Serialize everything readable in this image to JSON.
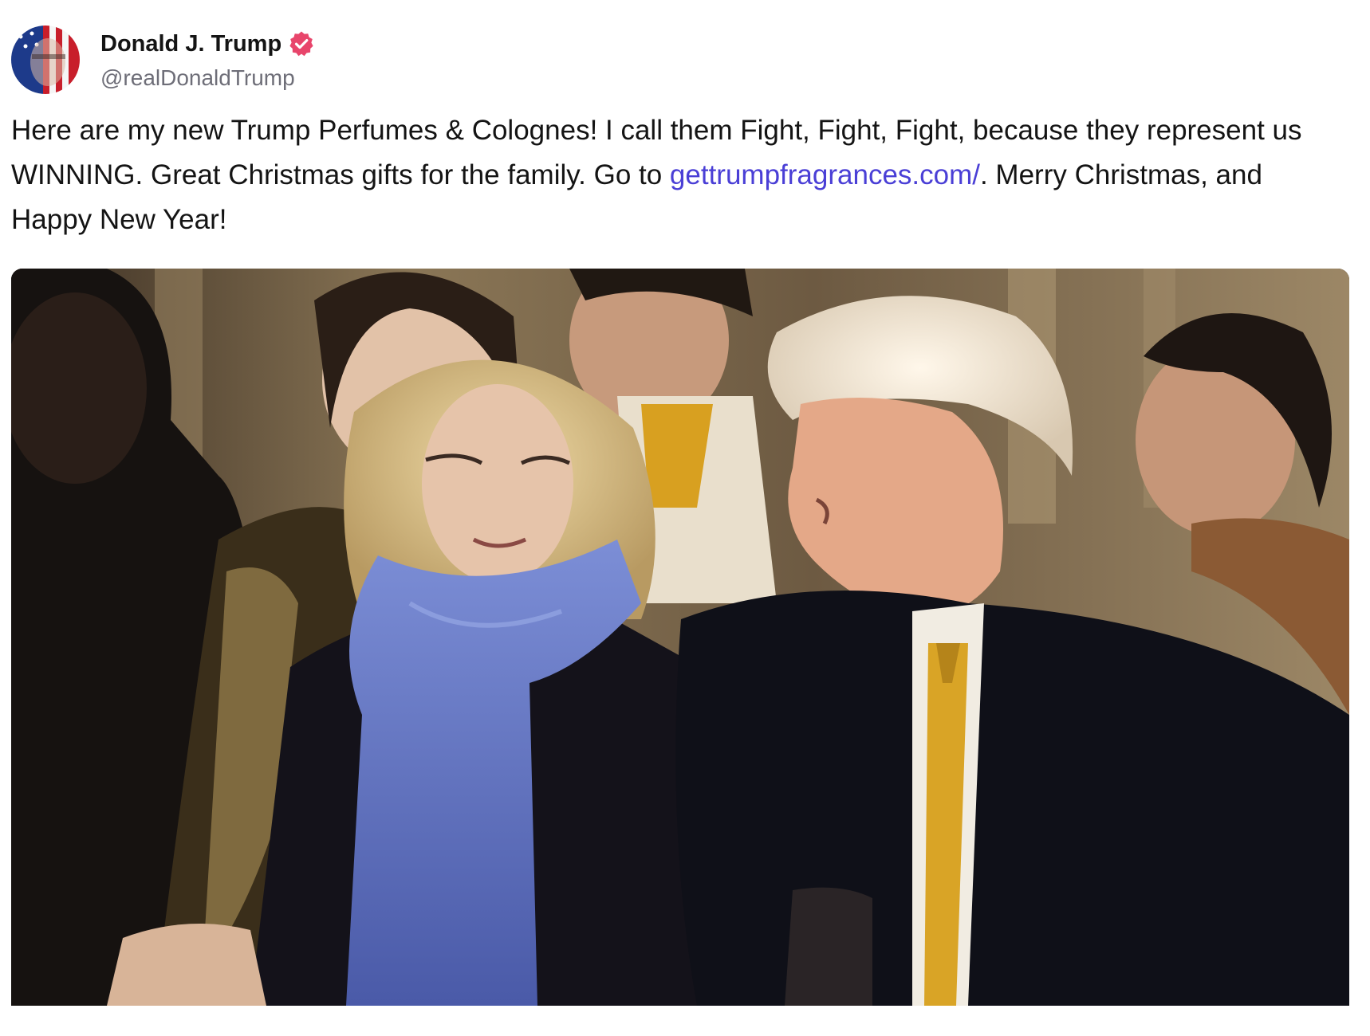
{
  "author": {
    "display_name": "Donald J. Trump",
    "handle": "@realDonaldTrump",
    "verified": true,
    "avatar_icon": "flag-portrait-avatar",
    "verified_icon": "verified-badge-icon",
    "verified_color": "#e8456b"
  },
  "post": {
    "text_part1": "Here are my new Trump Perfumes & Colognes! I call them Fight, Fight, Fight, because they represent us WINNING. Great Christmas gifts for the family. Go to ",
    "link_text": "gettrumpfragrances.com/",
    "text_part2": ". Merry Christmas, and Happy New Year!",
    "link_color": "#4a3fd6"
  },
  "media": {
    "kind": "photo",
    "icon": "photo-attachment"
  }
}
